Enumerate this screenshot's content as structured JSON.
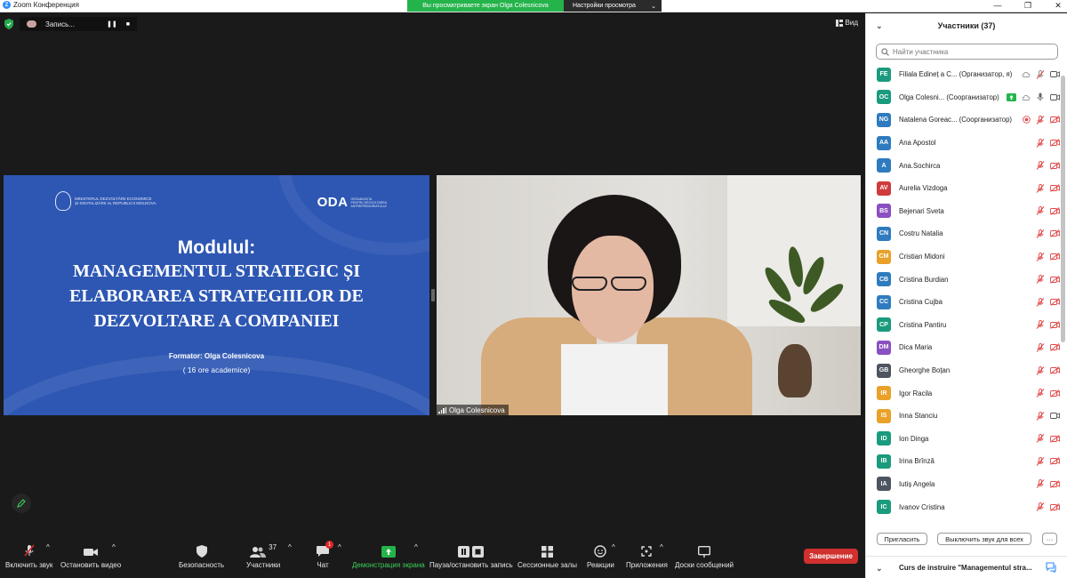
{
  "window": {
    "title": "Zoom Конференция",
    "minimize": "—",
    "maximize": "❐",
    "close": "✕"
  },
  "viewing_banner": "Вы просматриваете экран Olga Colesnicova",
  "view_settings": {
    "label": "Настройки просмотра",
    "caret": "⌄"
  },
  "recording": {
    "label": "Запись..."
  },
  "view_button": "Вид",
  "slide": {
    "ministry_line1": "MINISTERUL DEZVOLTĂRII ECONOMICE",
    "ministry_line2": "ȘI DIGITALIZĂRII AL REPUBLICII MOLDOVA",
    "oda_brand": "ODA",
    "oda_sub_line1": "ORGANIZAȚIA",
    "oda_sub_line2": "PENTRU DEZVOLTAREA",
    "oda_sub_line3": "ANTREPRENORIATULUI",
    "module": "Modulul:",
    "title_line1": "MANAGEMENTUL STRATEGIC ȘI",
    "title_line2": "ELABORAREA STRATEGIILOR DE",
    "title_line3": "DEZVOLTARE A COMPANIEI",
    "trainer": "Formator: Olga Colesnicova",
    "hours": "( 16 ore academice)"
  },
  "video": {
    "name": "Olga Colesnicova"
  },
  "toolbar": {
    "unmute": "Включить звук",
    "start_video": "Остановить видео",
    "security": "Безопасность",
    "participants": "Участники",
    "participants_count": "37",
    "chat": "Чат",
    "chat_badge": "1",
    "share": "Демонстрация экрана",
    "pause_recording": "Пауза/остановить запись",
    "breakout": "Сессионные залы",
    "reactions": "Реакции",
    "apps": "Приложения",
    "whiteboards": "Доски сообщений",
    "end": "Завершение",
    "caret": "^"
  },
  "panel": {
    "title": "Участники (37)",
    "collapse": "⌄",
    "search_placeholder": "Найти участника",
    "invite": "Пригласить",
    "mute_all": "Выключить звук для всех",
    "more": "···",
    "chat_title": "Curs de instruire \"Managementul stra..."
  },
  "colors": {
    "teal": "#1a9b7d",
    "blue": "#2f7bbf",
    "red": "#cf3b3b",
    "purple": "#8a4fc1",
    "orange": "#e9a12a",
    "gray": "#4d5560",
    "muted_icon": "#e04848",
    "toolbar_green": "#3ad05a"
  },
  "participants": [
    {
      "initials": "FE",
      "name": "Filiala Edineț a C...",
      "role": "(Организатор, я)",
      "color": "#1a9b7d",
      "mic": "off-gray",
      "video": "on"
    },
    {
      "initials": "OC",
      "name": "Olga Colesni...",
      "role": "(Соорганизатор)",
      "color": "#1a9b7d",
      "mic": "on",
      "video": "on",
      "sharing": true
    },
    {
      "initials": "NG",
      "name": "Natalena Goreac...",
      "role": "(Соорганизатор)",
      "color": "#2f7bbf",
      "mic": "off",
      "video": "off"
    },
    {
      "initials": "AA",
      "name": "Ana Apostol",
      "role": "",
      "color": "#2f7bbf",
      "mic": "off",
      "video": "off"
    },
    {
      "initials": "A",
      "name": "Ana.Sochirca",
      "role": "",
      "color": "#2f7bbf",
      "mic": "off",
      "video": "off"
    },
    {
      "initials": "AV",
      "name": "Aurelia Vizdoga",
      "role": "",
      "color": "#cf3b3b",
      "mic": "off",
      "video": "off"
    },
    {
      "initials": "BS",
      "name": "Bejenari Sveta",
      "role": "",
      "color": "#8a4fc1",
      "mic": "off",
      "video": "off"
    },
    {
      "initials": "CN",
      "name": "Costru Natalia",
      "role": "",
      "color": "#2f7bbf",
      "mic": "off",
      "video": "off"
    },
    {
      "initials": "CM",
      "name": "Cristian Midoni",
      "role": "",
      "color": "#e9a12a",
      "mic": "off",
      "video": "off"
    },
    {
      "initials": "CB",
      "name": "Cristina Burdian",
      "role": "",
      "color": "#2f7bbf",
      "mic": "off",
      "video": "off"
    },
    {
      "initials": "CC",
      "name": "Cristina Cujba",
      "role": "",
      "color": "#2f7bbf",
      "mic": "off",
      "video": "off"
    },
    {
      "initials": "CP",
      "name": "Cristina Pantiru",
      "role": "",
      "color": "#1a9b7d",
      "mic": "off",
      "video": "off"
    },
    {
      "initials": "DM",
      "name": "Dica Maria",
      "role": "",
      "color": "#8a4fc1",
      "mic": "off",
      "video": "off"
    },
    {
      "initials": "GB",
      "name": "Gheorghe Boțan",
      "role": "",
      "color": "#4d5560",
      "mic": "off",
      "video": "off"
    },
    {
      "initials": "IR",
      "name": "Igor Racila",
      "role": "",
      "color": "#e9a12a",
      "mic": "off",
      "video": "off"
    },
    {
      "initials": "IS",
      "name": "Inna Stanciu",
      "role": "",
      "color": "#e9a12a",
      "mic": "off",
      "video": "on"
    },
    {
      "initials": "ID",
      "name": "Ion Dinga",
      "role": "",
      "color": "#1a9b7d",
      "mic": "off",
      "video": "off"
    },
    {
      "initials": "IB",
      "name": "Irina Brînză",
      "role": "",
      "color": "#1a9b7d",
      "mic": "off",
      "video": "off"
    },
    {
      "initials": "IA",
      "name": "Iutiș Angela",
      "role": "",
      "color": "#4d5560",
      "mic": "off",
      "video": "off"
    },
    {
      "initials": "IC",
      "name": "Ivanov Cristina",
      "role": "",
      "color": "#1a9b7d",
      "mic": "off",
      "video": "off"
    }
  ]
}
